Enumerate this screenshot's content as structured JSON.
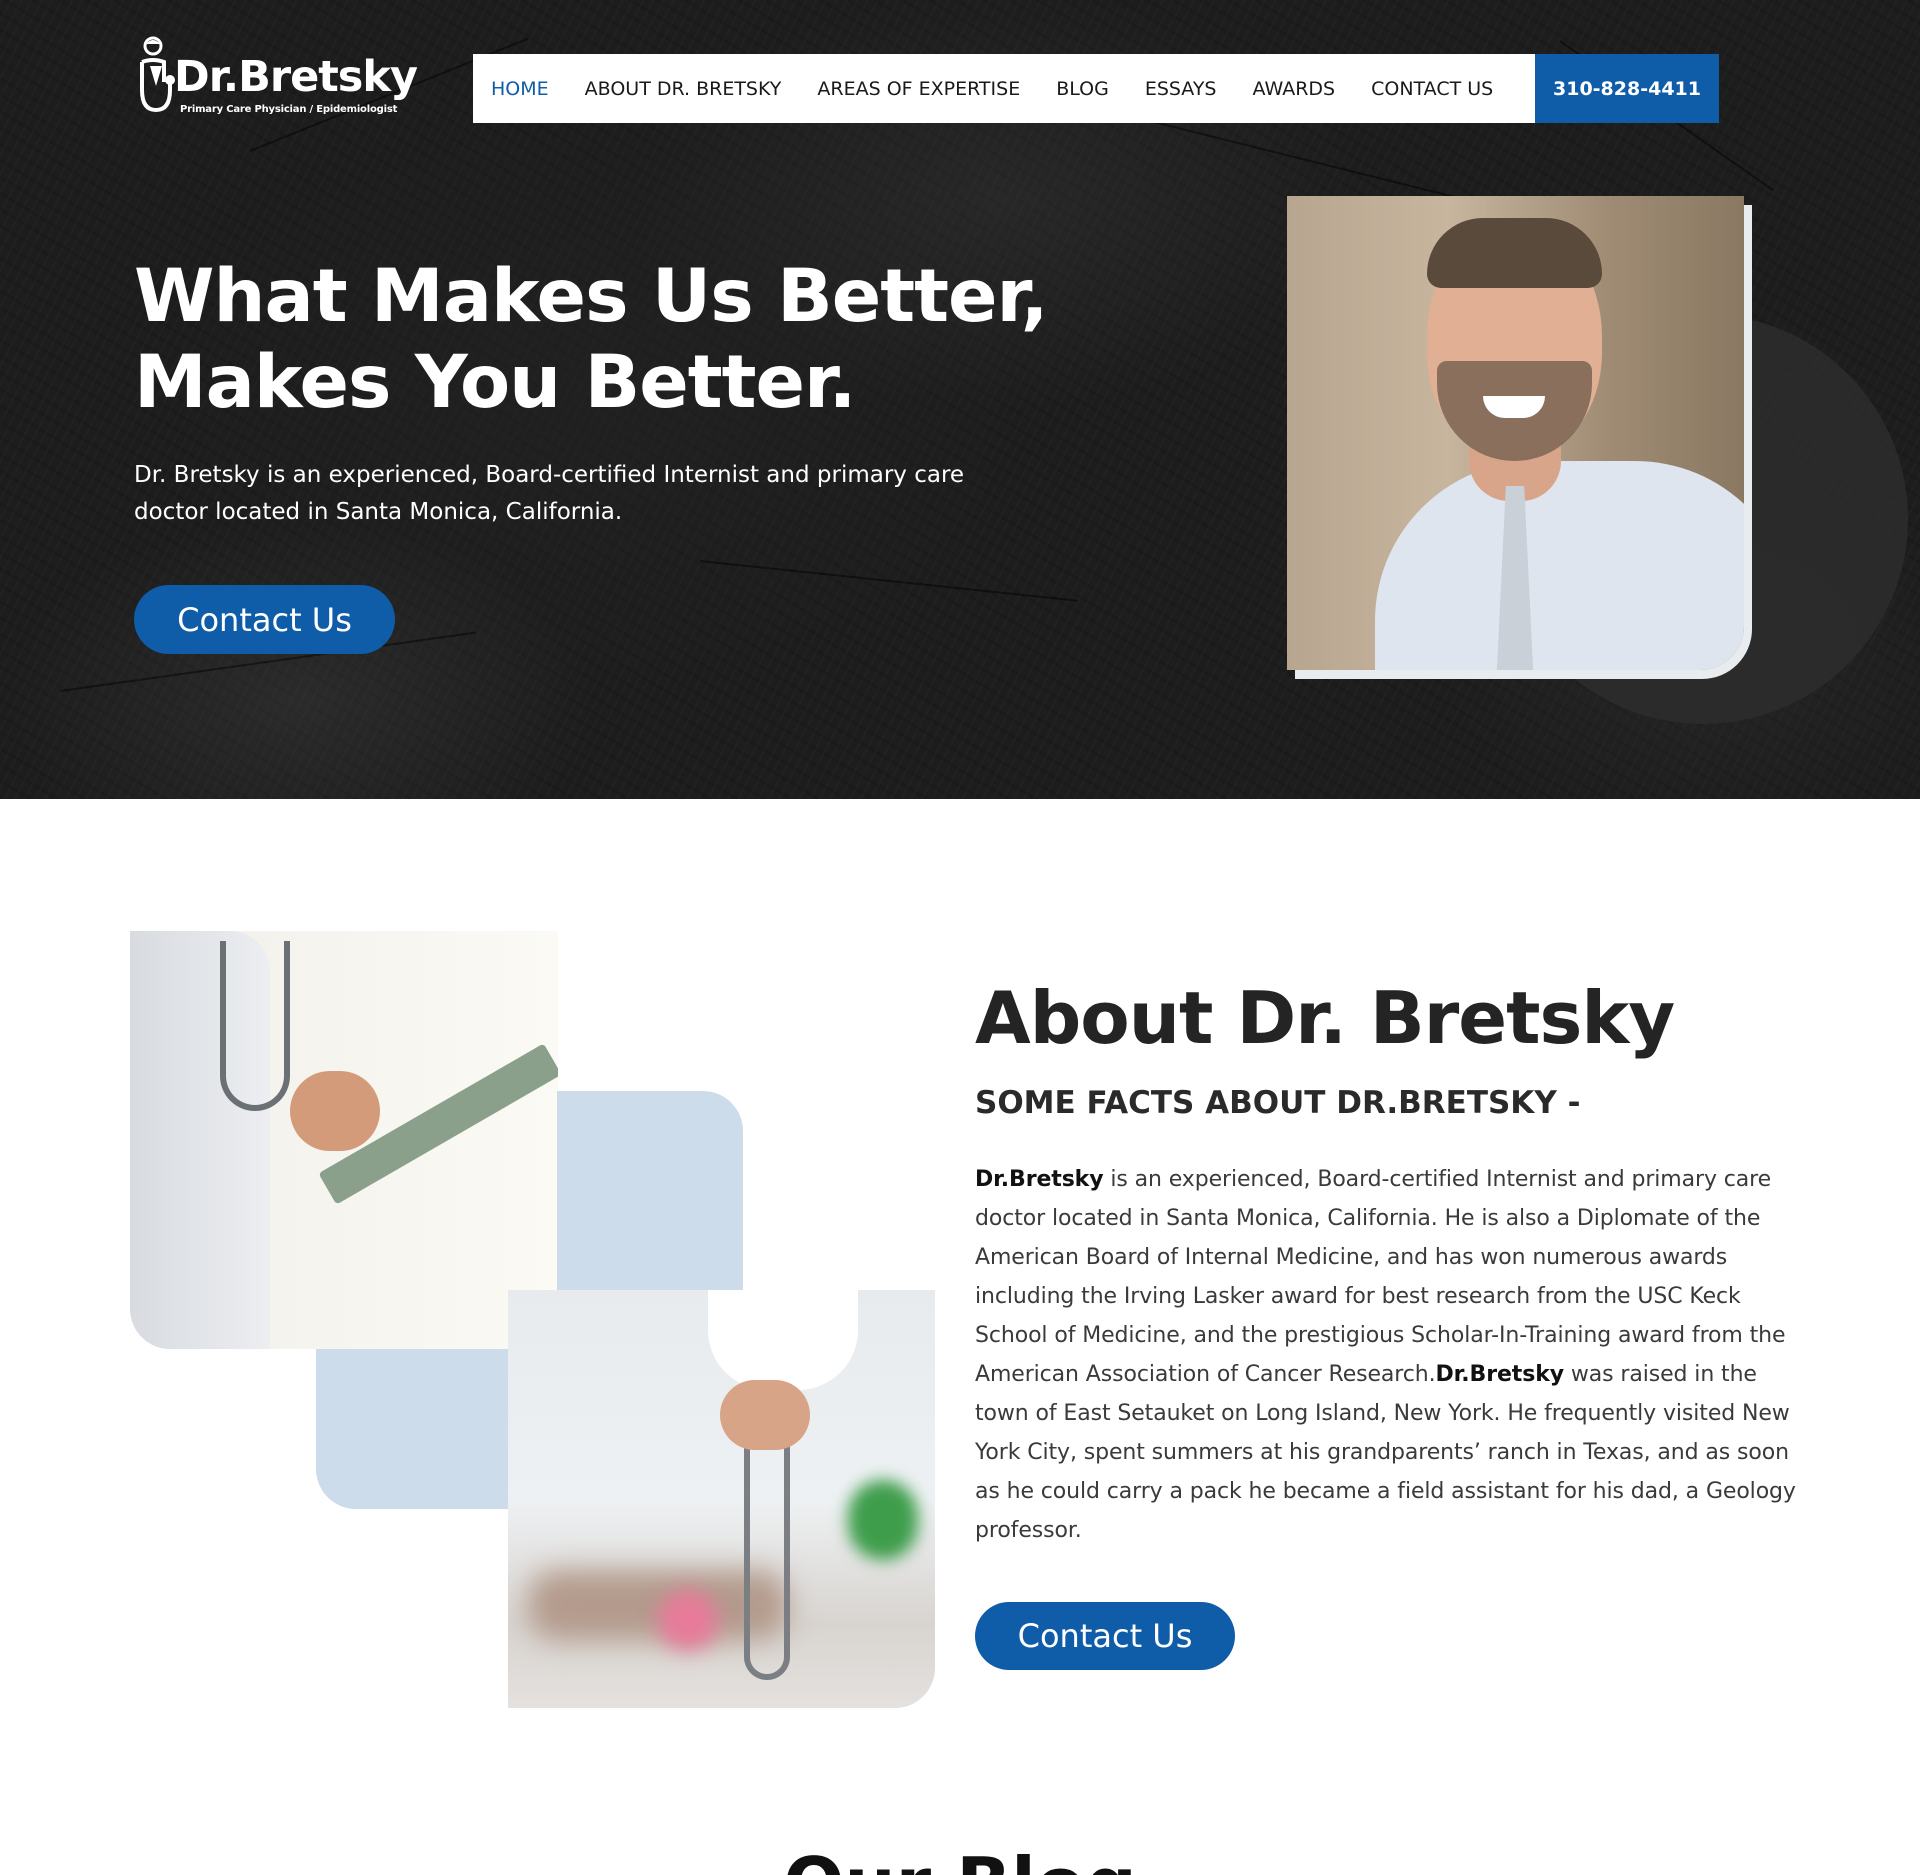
{
  "header": {
    "logo_text": "Dr.Bretsky",
    "logo_tagline": "Primary Care Physician / Epidemiologist",
    "nav": [
      {
        "label": "HOME",
        "active": true
      },
      {
        "label": "ABOUT DR. BRETSKY",
        "active": false
      },
      {
        "label": "AREAS OF EXPERTISE",
        "active": false
      },
      {
        "label": "BLOG",
        "active": false
      },
      {
        "label": "ESSAYS",
        "active": false
      },
      {
        "label": "AWARDS",
        "active": false
      },
      {
        "label": "CONTACT US",
        "active": false
      }
    ],
    "phone": "310-828-4411"
  },
  "hero": {
    "title_line1": "What Makes Us Better,",
    "title_line2": "Makes You Better.",
    "description": "Dr. Bretsky is an experienced, Board-certified Internist and primary care doctor located in Santa Monica, California.",
    "button_label": "Contact Us"
  },
  "about": {
    "title": "About Dr. Bretsky",
    "subtitle": "SOME FACTS ABOUT DR.BRETSKY -",
    "name_bold_1": "Dr.Bretsky",
    "paragraph_part1": "  is an experienced, Board-certified Internist and primary care doctor located in Santa Monica, California. He is also a Diplomate of the American Board of Internal Medicine, and has won numerous awards including the Irving Lasker award for best research from the USC Keck School of Medicine, and the prestigious Scholar-In-Training award from the American Association of Cancer Research.",
    "name_bold_2": "Dr.Bretsky",
    "paragraph_part2": " was raised in the town of East Setauket on Long Island, New York. He frequently visited New York City, spent summers at his grandparents’ ranch in Texas, and as soon as he could carry a pack he became a field assistant for his dad, a Geology professor.",
    "button_label": "Contact Us"
  },
  "blog": {
    "title": "Our Blog"
  },
  "colors": {
    "brand_blue": "#0f5ca8",
    "light_blue": "#cddceb",
    "hero_bg": "#1d1d1d"
  },
  "icons": {
    "logo_mark": "doctor-stethoscope-icon"
  }
}
